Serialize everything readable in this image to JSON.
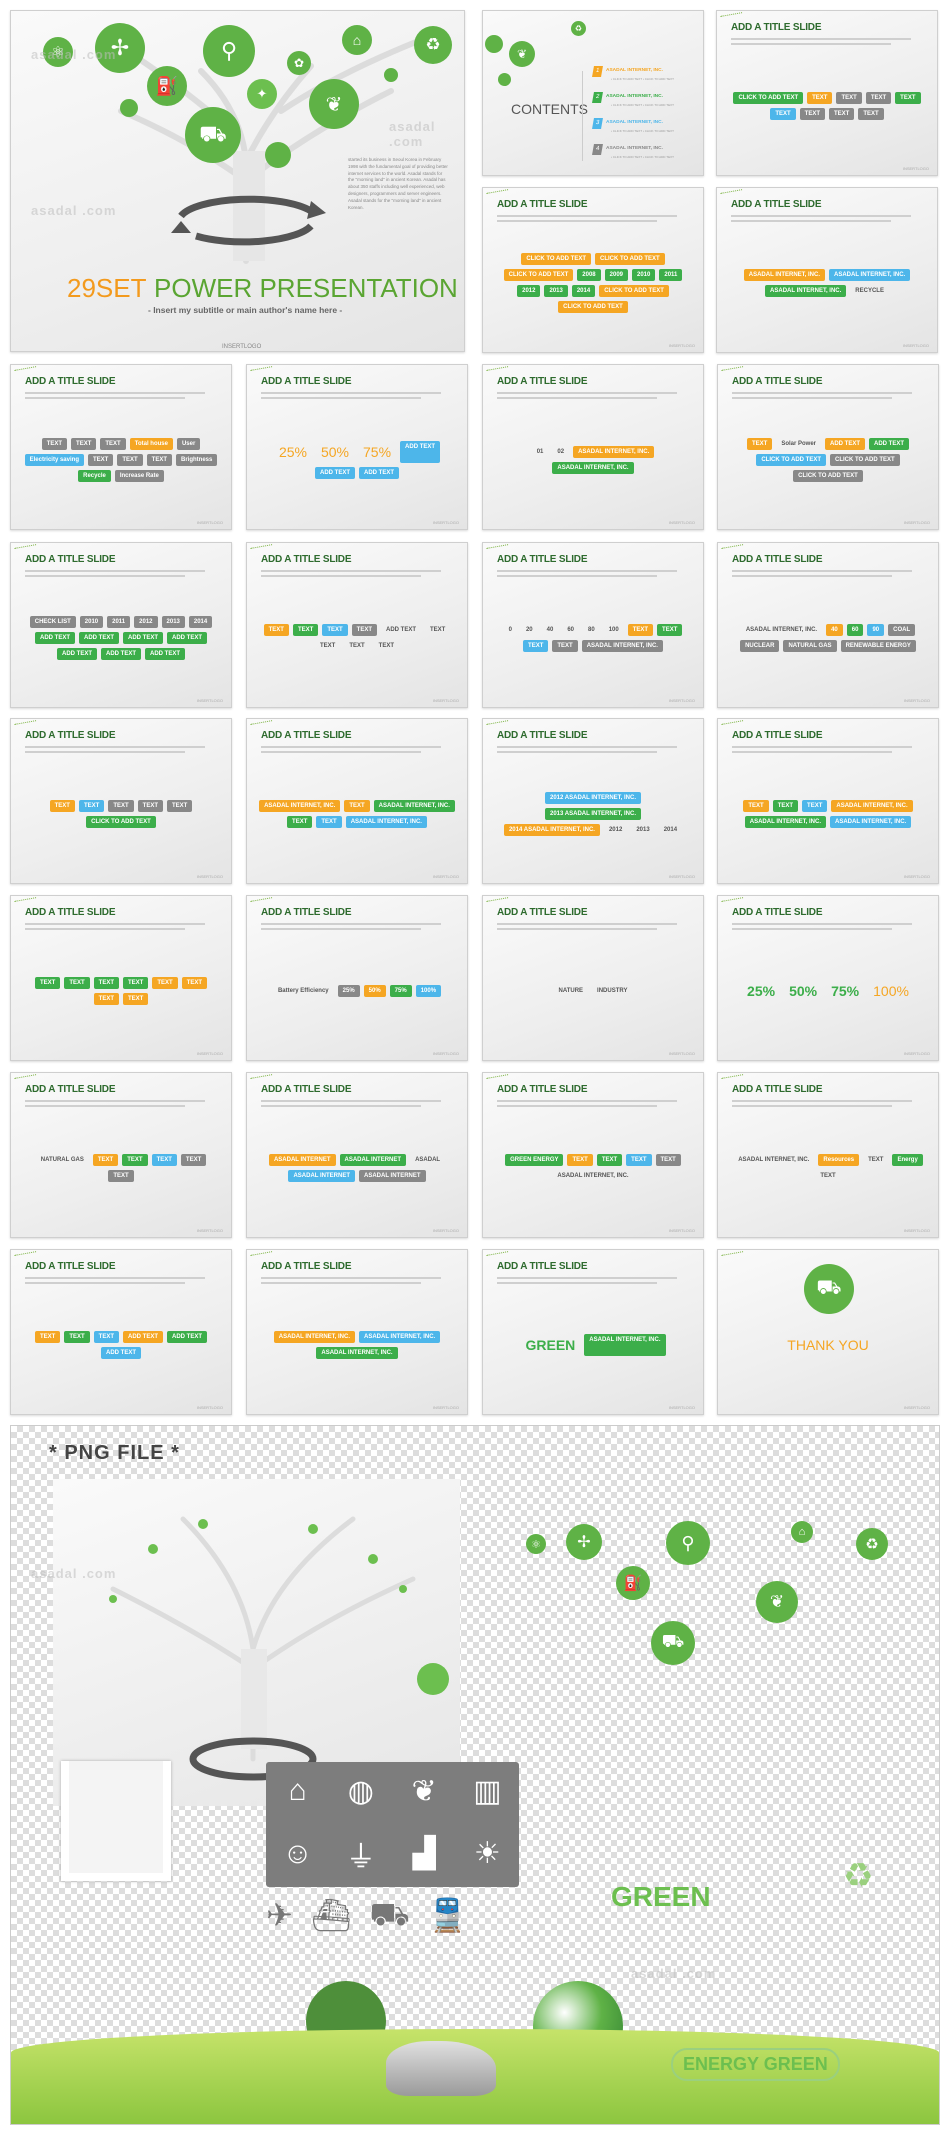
{
  "watermark": "asadal .com",
  "main_slide": {
    "title_number": "29SET",
    "title_main": "POWER PRESENTATION",
    "subtitle": "- Insert my subtitle or main author's name here -",
    "body": "started its business in Seoul Korea in February 1998 with the fundamental goal of providing better internet services to the world. Asadal stands for the \"morning land\" in ancient Korean. Asadal has about 350 staffs including well experienced, web designers, programmers and server engineers. Asadal stands for the \"morning land\" in ancient Korean.",
    "logo": "INSERTLOGO",
    "tree_icons": [
      "atom-icon",
      "wind-turbine-icon",
      "faucet-icon",
      "fuel-pump-icon",
      "ladybug-icon",
      "bird-icon",
      "factory-icon",
      "recycle-bag-icon",
      "plant-hand-icon",
      "electric-car-icon"
    ]
  },
  "contents_slide": {
    "title": "CONTENTS",
    "items": [
      {
        "num": "1",
        "label": "ASADAL INTERNET, INC.",
        "sub": "• CLICK TO ADD TEXT  • CLICK TO ADD TEXT",
        "color": "#f5a623"
      },
      {
        "num": "2",
        "label": "ASADAL INTERNET, INC.",
        "sub": "• CLICK TO ADD TEXT  • CLICK TO ADD TEXT",
        "color": "#3cae4a"
      },
      {
        "num": "3",
        "label": "ASADAL INTERNET, INC.",
        "sub": "• CLICK TO ADD TEXT  • CLICK TO ADD TEXT",
        "color": "#4db6ea"
      },
      {
        "num": "4",
        "label": "ASADAL INTERNET, INC.",
        "sub": "• CLICK TO ADD TEXT  • CLICK TO ADD TEXT",
        "color": "#888888"
      }
    ]
  },
  "slide_logo": "INSERTLOGO",
  "slides": [
    {
      "title": "ADD A TITLE SLIDE",
      "chips": [
        [
          "CLICK TO ADD TEXT",
          "green"
        ],
        [
          "TEXT",
          "orange"
        ],
        [
          "TEXT",
          "gray"
        ],
        [
          "TEXT",
          "gray"
        ],
        [
          "TEXT",
          "green"
        ],
        [
          "TEXT",
          "blue"
        ],
        [
          "TEXT",
          "gray"
        ],
        [
          "TEXT",
          "gray"
        ],
        [
          "TEXT",
          "gray"
        ]
      ]
    },
    {
      "title": "ADD A TITLE SLIDE",
      "chips": [
        [
          "CLICK TO ADD TEXT",
          "orange"
        ],
        [
          "CLICK TO ADD TEXT",
          "orange"
        ],
        [
          "CLICK TO ADD TEXT",
          "orange"
        ],
        [
          "2008",
          "green"
        ],
        [
          "2009",
          "green"
        ],
        [
          "2010",
          "green"
        ],
        [
          "2011",
          "green"
        ],
        [
          "2012",
          "green"
        ],
        [
          "2013",
          "green"
        ],
        [
          "2014",
          "green"
        ],
        [
          "CLICK TO ADD TEXT",
          "orange"
        ],
        [
          "CLICK TO ADD TEXT",
          "orange"
        ]
      ]
    },
    {
      "title": "ADD A TITLE SLIDE",
      "chips": [
        [
          "ASADAL INTERNET, INC.",
          "orange"
        ],
        [
          "ASADAL INTERNET, INC.",
          "blue"
        ],
        [
          "ASADAL INTERNET, INC.",
          "green"
        ],
        [
          "RECYCLE",
          "text"
        ]
      ]
    },
    {
      "title": "ADD A TITLE SLIDE",
      "chips": [
        [
          "TEXT",
          "gray"
        ],
        [
          "TEXT",
          "gray"
        ],
        [
          "TEXT",
          "gray"
        ],
        [
          "Total house",
          "orange"
        ],
        [
          "User",
          "gray"
        ],
        [
          "Electricity saving",
          "blue"
        ],
        [
          "TEXT",
          "gray"
        ],
        [
          "TEXT",
          "gray"
        ],
        [
          "TEXT",
          "gray"
        ],
        [
          "Brightness",
          "gray"
        ],
        [
          "Recycle",
          "green"
        ],
        [
          "Increase Rate",
          "gray"
        ]
      ]
    },
    {
      "title": "ADD A TITLE SLIDE",
      "chips": [
        [
          "25%",
          "big"
        ],
        [
          "50%",
          "big"
        ],
        [
          "75%",
          "big"
        ],
        [
          "ADD TEXT",
          "blue"
        ],
        [
          "ADD TEXT",
          "blue"
        ],
        [
          "ADD TEXT",
          "blue"
        ]
      ]
    },
    {
      "title": "ADD A TITLE SLIDE",
      "chips": [
        [
          "01",
          "text"
        ],
        [
          "02",
          "text"
        ],
        [
          "ASADAL INTERNET, INC.",
          "orange"
        ],
        [
          "ASADAL INTERNET, INC.",
          "green"
        ]
      ]
    },
    {
      "title": "ADD A TITLE SLIDE",
      "chips": [
        [
          "TEXT",
          "orange"
        ],
        [
          "Solar Power",
          "text"
        ],
        [
          "ADD TEXT",
          "orange"
        ],
        [
          "ADD TEXT",
          "green"
        ],
        [
          "CLICK TO ADD TEXT",
          "blue"
        ],
        [
          "CLICK TO ADD TEXT",
          "gray"
        ],
        [
          "CLICK TO ADD TEXT",
          "gray"
        ]
      ]
    },
    {
      "title": "ADD A TITLE SLIDE",
      "chips": [
        [
          "CHECK LIST",
          "gray"
        ],
        [
          "2010",
          "gray"
        ],
        [
          "2011",
          "gray"
        ],
        [
          "2012",
          "gray"
        ],
        [
          "2013",
          "gray"
        ],
        [
          "2014",
          "gray"
        ],
        [
          "ADD TEXT",
          "green"
        ],
        [
          "ADD TEXT",
          "green"
        ],
        [
          "ADD TEXT",
          "green"
        ],
        [
          "ADD TEXT",
          "green"
        ],
        [
          "ADD TEXT",
          "green"
        ],
        [
          "ADD TEXT",
          "green"
        ],
        [
          "ADD TEXT",
          "green"
        ]
      ]
    },
    {
      "title": "ADD A TITLE SLIDE",
      "chips": [
        [
          "TEXT",
          "orange"
        ],
        [
          "TEXT",
          "green"
        ],
        [
          "TEXT",
          "blue"
        ],
        [
          "TEXT",
          "gray"
        ],
        [
          "ADD TEXT",
          "text"
        ],
        [
          "TEXT",
          "text"
        ],
        [
          "TEXT",
          "text"
        ],
        [
          "TEXT",
          "text"
        ],
        [
          "TEXT",
          "text"
        ]
      ]
    },
    {
      "title": "ADD A TITLE SLIDE",
      "chips": [
        [
          "0",
          "text"
        ],
        [
          "20",
          "text"
        ],
        [
          "40",
          "text"
        ],
        [
          "60",
          "text"
        ],
        [
          "80",
          "text"
        ],
        [
          "100",
          "text"
        ],
        [
          "TEXT",
          "orange"
        ],
        [
          "TEXT",
          "green"
        ],
        [
          "TEXT",
          "blue"
        ],
        [
          "TEXT",
          "gray"
        ],
        [
          "ASADAL INTERNET, INC.",
          "gray"
        ]
      ]
    },
    {
      "title": "ADD A TITLE SLIDE",
      "chips": [
        [
          "ASADAL INTERNET, INC.",
          "text"
        ],
        [
          "40",
          "orange"
        ],
        [
          "60",
          "green"
        ],
        [
          "90",
          "blue"
        ],
        [
          "COAL",
          "gray"
        ],
        [
          "NUCLEAR",
          "gray"
        ],
        [
          "NATURAL GAS",
          "gray"
        ],
        [
          "RENEWABLE ENERGY",
          "gray"
        ]
      ]
    },
    {
      "title": "ADD A TITLE SLIDE",
      "chips": [
        [
          "TEXT",
          "orange"
        ],
        [
          "TEXT",
          "blue"
        ],
        [
          "TEXT",
          "gray"
        ],
        [
          "TEXT",
          "gray"
        ],
        [
          "TEXT",
          "gray"
        ],
        [
          "CLICK TO ADD TEXT",
          "green"
        ]
      ]
    },
    {
      "title": "ADD A TITLE SLIDE",
      "chips": [
        [
          "ASADAL INTERNET, INC.",
          "orange"
        ],
        [
          "TEXT",
          "orange"
        ],
        [
          "ASADAL INTERNET, INC.",
          "green"
        ],
        [
          "TEXT",
          "green"
        ],
        [
          "TEXT",
          "blue"
        ],
        [
          "ASADAL INTERNET, INC.",
          "blue"
        ]
      ]
    },
    {
      "title": "ADD A TITLE SLIDE",
      "chips": [
        [
          "2012 ASADAL INTERNET, INC.",
          "blue"
        ],
        [
          "2013 ASADAL INTERNET, INC.",
          "green"
        ],
        [
          "2014 ASADAL INTERNET, INC.",
          "orange"
        ],
        [
          "2012",
          "text"
        ],
        [
          "2013",
          "text"
        ],
        [
          "2014",
          "text"
        ]
      ]
    },
    {
      "title": "ADD A TITLE SLIDE",
      "chips": [
        [
          "TEXT",
          "orange"
        ],
        [
          "TEXT",
          "green"
        ],
        [
          "TEXT",
          "blue"
        ],
        [
          "ASADAL INTERNET, INC.",
          "orange"
        ],
        [
          "ASADAL INTERNET, INC.",
          "green"
        ],
        [
          "ASADAL INTERNET, INC.",
          "blue"
        ]
      ]
    },
    {
      "title": "ADD A TITLE SLIDE",
      "chips": [
        [
          "TEXT",
          "green"
        ],
        [
          "TEXT",
          "green"
        ],
        [
          "TEXT",
          "green"
        ],
        [
          "TEXT",
          "green"
        ],
        [
          "TEXT",
          "orange"
        ],
        [
          "TEXT",
          "orange"
        ],
        [
          "TEXT",
          "orange"
        ],
        [
          "TEXT",
          "orange"
        ]
      ]
    },
    {
      "title": "ADD A TITLE SLIDE",
      "chips": [
        [
          "Battery Efficiency",
          "text"
        ],
        [
          "25%",
          "gray"
        ],
        [
          "50%",
          "orange"
        ],
        [
          "75%",
          "green"
        ],
        [
          "100%",
          "blue"
        ]
      ]
    },
    {
      "title": "ADD A TITLE SLIDE",
      "chips": [
        [
          "NATURE",
          "text"
        ],
        [
          "INDUSTRY",
          "text"
        ]
      ]
    },
    {
      "title": "ADD A TITLE SLIDE",
      "chips": [
        [
          "25%",
          "bigg"
        ],
        [
          "50%",
          "bigg"
        ],
        [
          "75%",
          "bigg"
        ],
        [
          "100%",
          "big"
        ]
      ]
    },
    {
      "title": "ADD A TITLE SLIDE",
      "chips": [
        [
          "NATURAL GAS",
          "text"
        ],
        [
          "TEXT",
          "orange"
        ],
        [
          "TEXT",
          "green"
        ],
        [
          "TEXT",
          "blue"
        ],
        [
          "TEXT",
          "gray"
        ],
        [
          "TEXT",
          "gray"
        ]
      ]
    },
    {
      "title": "ADD A TITLE SLIDE",
      "chips": [
        [
          "ASADAL INTERNET",
          "orange"
        ],
        [
          "ASADAL INTERNET",
          "green"
        ],
        [
          "ASADAL",
          "text"
        ],
        [
          "ASADAL INTERNET",
          "blue"
        ],
        [
          "ASADAL INTERNET",
          "gray"
        ]
      ]
    },
    {
      "title": "ADD A TITLE SLIDE",
      "chips": [
        [
          "GREEN ENERGY",
          "green"
        ],
        [
          "TEXT",
          "orange"
        ],
        [
          "TEXT",
          "green"
        ],
        [
          "TEXT",
          "blue"
        ],
        [
          "TEXT",
          "gray"
        ],
        [
          "ASADAL INTERNET, INC.",
          "text"
        ]
      ]
    },
    {
      "title": "ADD A TITLE SLIDE",
      "chips": [
        [
          "ASADAL INTERNET, INC.",
          "text"
        ],
        [
          "Resources",
          "orange"
        ],
        [
          "TEXT",
          "text"
        ],
        [
          "Energy",
          "green"
        ],
        [
          "TEXT",
          "text"
        ]
      ]
    },
    {
      "title": "ADD A TITLE SLIDE",
      "chips": [
        [
          "TEXT",
          "orange"
        ],
        [
          "TEXT",
          "green"
        ],
        [
          "TEXT",
          "blue"
        ],
        [
          "ADD TEXT",
          "orange"
        ],
        [
          "ADD TEXT",
          "green"
        ],
        [
          "ADD TEXT",
          "blue"
        ]
      ]
    },
    {
      "title": "ADD A TITLE SLIDE",
      "chips": [
        [
          "ASADAL INTERNET, INC.",
          "orange"
        ],
        [
          "ASADAL INTERNET, INC.",
          "blue"
        ],
        [
          "ASADAL INTERNET, INC.",
          "green"
        ]
      ]
    },
    {
      "title": "ADD A TITLE SLIDE",
      "chips": [
        [
          "GREEN",
          "bigg"
        ],
        [
          "ASADAL INTERNET, INC.",
          "green"
        ]
      ]
    },
    {
      "title": "",
      "chips": [
        [
          "THANK YOU",
          "big"
        ]
      ]
    }
  ],
  "png_section": {
    "title": "* PNG FILE *",
    "icon_panel": [
      "home-icon",
      "globe-icon",
      "handshake-plant-icon",
      "trash-icon",
      "users-icon",
      "plug-icon",
      "growth-chart-icon",
      "lightbulb-icon"
    ],
    "transport_icons": [
      "airplane-icon",
      "ship-icon",
      "car-icon",
      "train-icon"
    ],
    "green_text": "GREEN",
    "energy_green_text": "ENERGY GREEN"
  }
}
